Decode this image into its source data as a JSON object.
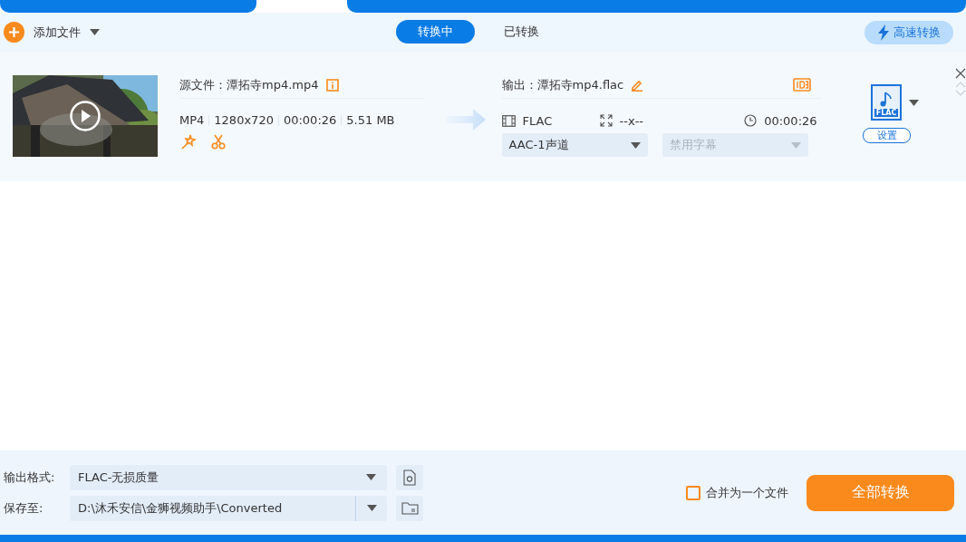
{
  "toolbar": {
    "add_file": "添加文件",
    "views": [
      {
        "label": "转换中",
        "selected": true
      },
      {
        "label": "已转换",
        "selected": false
      }
    ],
    "turbo": "高速转换"
  },
  "file": {
    "source_label": "源文件：",
    "source_name": "潭拓寺mp4.mp4",
    "meta": [
      "MP4",
      "1280x720",
      "00:00:26",
      "5.51 MB"
    ],
    "output_label": "输出：",
    "output_name": "潭拓寺mp4.flac",
    "format": "FLAC",
    "resolution": "--x--",
    "duration": "00:00:26",
    "audio_track": "AAC-1声道",
    "subtitle": {
      "value": "禁用字幕",
      "disabled": true
    },
    "format_badge": "FLAC",
    "settings": "设置"
  },
  "bottom": {
    "format_label": "输出格式:",
    "format_value": "FLAC-无损质量",
    "save_label": "保存至:",
    "save_value": "D:\\沐禾安信\\金狮视频助手\\Converted",
    "merge": {
      "label": "合并为一个文件",
      "checked": false
    },
    "convert_all": "全部转换"
  }
}
